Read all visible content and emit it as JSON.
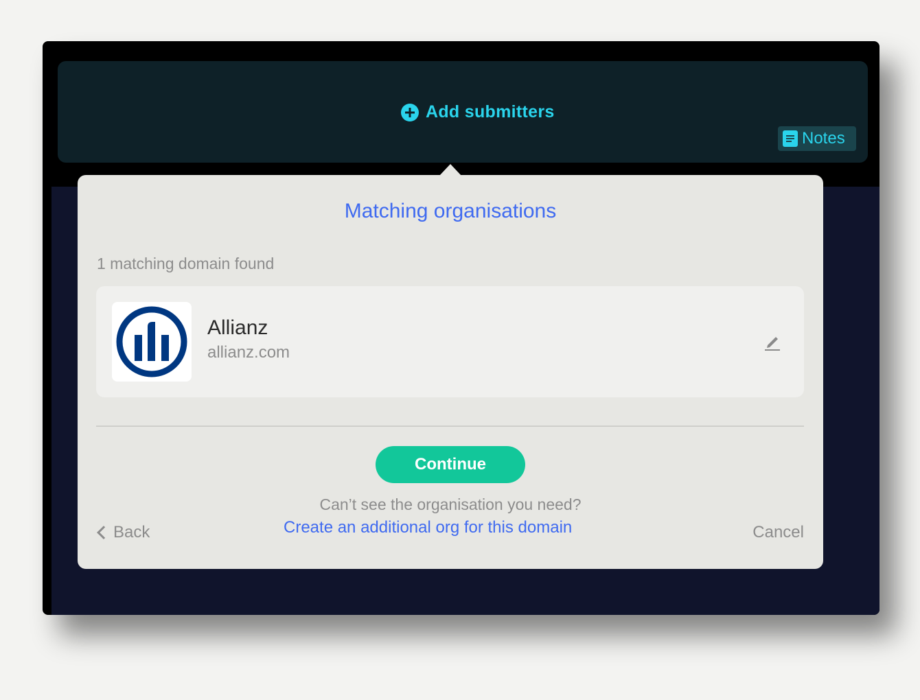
{
  "header": {
    "add_submitters_label": "Add submitters",
    "notes_label": "Notes",
    "icons": {
      "add": "plus-circle-icon",
      "notes": "document-icon"
    }
  },
  "modal": {
    "title": "Matching organisations",
    "match_count_text": "1 matching domain found",
    "organisation": {
      "name": "Allianz",
      "domain": "allianz.com",
      "logo": "allianz-logo",
      "edit_icon": "pencil-icon"
    },
    "continue_label": "Continue",
    "cant_see_text": "Can’t see the organisation you need?",
    "create_link_label": "Create an additional org for this domain",
    "back_label": "Back",
    "cancel_label": "Cancel"
  },
  "colors": {
    "accent_cyan": "#2ad4ec",
    "link_blue": "#3f6af0",
    "continue_green": "#12c79a",
    "brand_navy": "#003781"
  }
}
